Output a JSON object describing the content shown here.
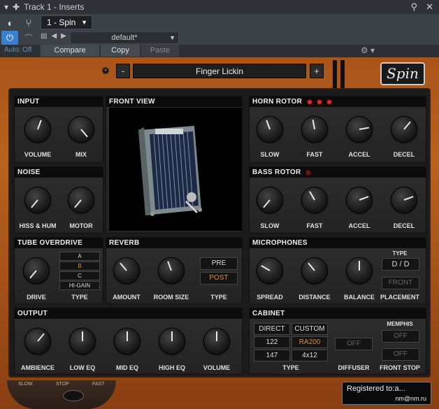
{
  "host": {
    "title": "Track 1 - Inserts",
    "slot_label": "1 - Spin",
    "preset_default": "default*",
    "auto_label": "Auto: Off",
    "compare": "Compare",
    "copy": "Copy",
    "paste": "Paste"
  },
  "plugin": {
    "preset_name": "Finger Lickin",
    "prev": "-",
    "next": "+",
    "logo": "Spin"
  },
  "input": {
    "title": "INPUT",
    "knobs": [
      {
        "label": "VOLUME"
      },
      {
        "label": "MIX"
      }
    ]
  },
  "noise": {
    "title": "NOISE",
    "knobs": [
      {
        "label": "HISS & HUM"
      },
      {
        "label": "MOTOR"
      }
    ]
  },
  "tube": {
    "title": "TUBE OVERDRIVE",
    "drive": "DRIVE",
    "type_label": "TYPE",
    "types": [
      "A",
      "B",
      "C",
      "HI-GAIN"
    ],
    "selected": "B"
  },
  "front": {
    "title": "FRONT VIEW"
  },
  "reverb": {
    "title": "REVERB",
    "knobs": [
      {
        "label": "AMOUNT"
      },
      {
        "label": "ROOM SIZE"
      }
    ],
    "type_label": "TYPE",
    "pre": "PRE",
    "post": "POST"
  },
  "output": {
    "title": "OUTPUT",
    "knobs": [
      {
        "label": "AMBIENCE"
      },
      {
        "label": "LOW EQ"
      },
      {
        "label": "MID EQ"
      },
      {
        "label": "HIGH EQ"
      },
      {
        "label": "VOLUME"
      }
    ]
  },
  "horn": {
    "title": "HORN ROTOR",
    "knobs": [
      {
        "label": "SLOW"
      },
      {
        "label": "FAST"
      },
      {
        "label": "ACCEL"
      },
      {
        "label": "DECEL"
      }
    ]
  },
  "bass": {
    "title": "BASS ROTOR",
    "knobs": [
      {
        "label": "SLOW"
      },
      {
        "label": "FAST"
      },
      {
        "label": "ACCEL"
      },
      {
        "label": "DECEL"
      }
    ]
  },
  "mics": {
    "title": "MICROPHONES",
    "knobs": [
      {
        "label": "SPREAD"
      },
      {
        "label": "DISTANCE"
      },
      {
        "label": "BALANCE"
      }
    ],
    "type_label": "TYPE",
    "type_value": "D / D",
    "front": "FRONT",
    "placement": "PLACEMENT"
  },
  "cabinet": {
    "title": "CABINET",
    "cells": [
      "DIRECT",
      "CUSTOM",
      "122",
      "RA200",
      "147",
      "4x12"
    ],
    "type_label": "TYPE",
    "diffuser_btn": "OFF",
    "diffuser_label": "DIFFUSER",
    "memphis": "MEMPHIS",
    "memphis_btn": "OFF",
    "front_stop_btn": "OFF",
    "front_stop_label": "FRONT STOP"
  },
  "speed": {
    "slow": "SLOW",
    "stop": "STOP",
    "fast": "FAST"
  },
  "registration": {
    "line1": "Registered to:a...",
    "line2": "nm@nm.ru"
  }
}
